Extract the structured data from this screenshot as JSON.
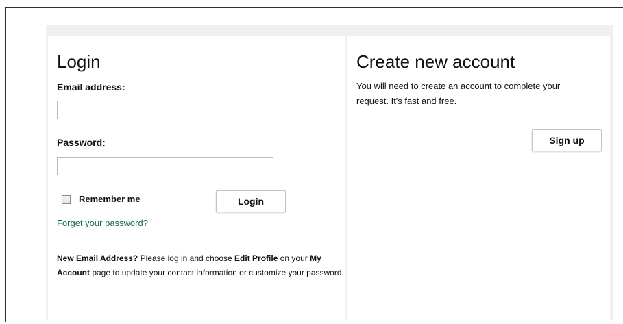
{
  "login": {
    "heading": "Login",
    "email_label": "Email address:",
    "email_value": "",
    "password_label": "Password:",
    "password_value": "",
    "remember_label": "Remember me",
    "remember_checked": false,
    "login_button": "Login",
    "forgot_link": "Forget your password?",
    "note": {
      "part1": "New Email Address?",
      "part2": " Please log in and choose ",
      "part3": "Edit Profile",
      "part4": " on your ",
      "part5": "My Account",
      "part6": " page to update your contact information or customize your password."
    }
  },
  "signup": {
    "heading": "Create new account",
    "description": "You will need to create an account to complete your request. It's fast and free.",
    "button": "Sign up"
  },
  "colors": {
    "link": "#136c5a",
    "panel_background": "#f0f0f0",
    "text": "#111111"
  }
}
